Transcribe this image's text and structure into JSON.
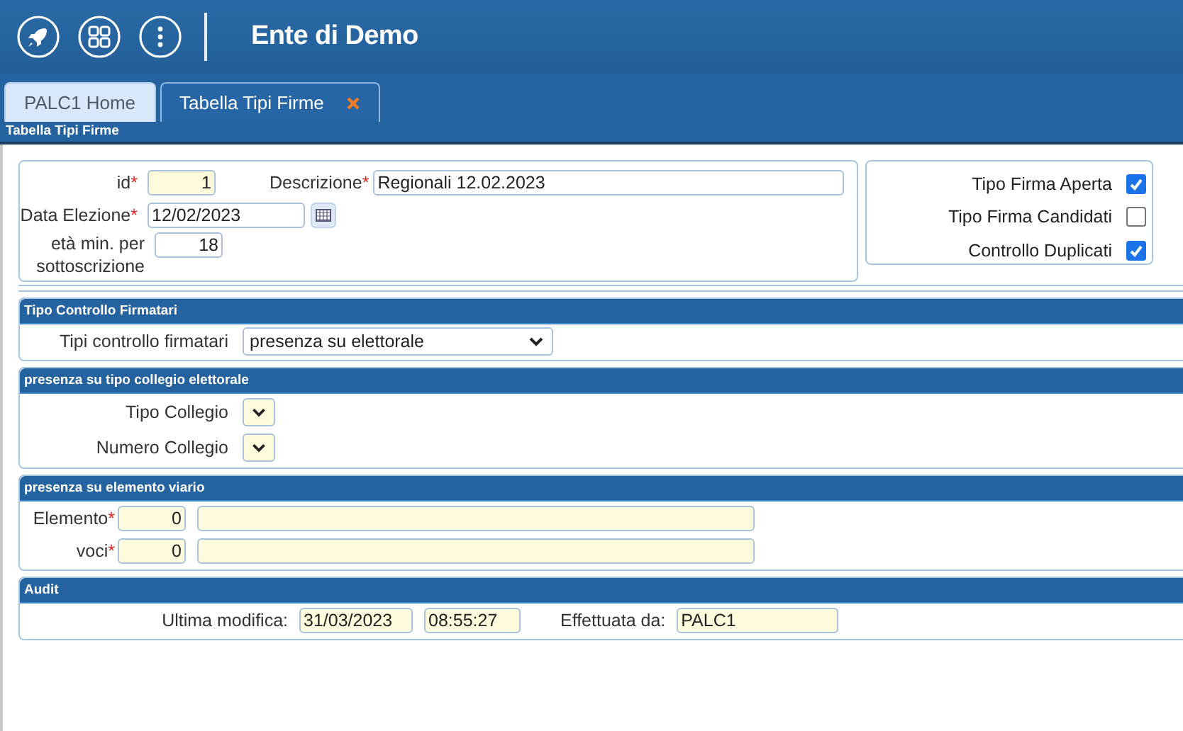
{
  "header": {
    "title": "Ente di Demo"
  },
  "tabs": [
    {
      "label": "PALC1 Home",
      "selected": false,
      "closable": false
    },
    {
      "label": "Tabella Tipi Firme",
      "selected": true,
      "closable": true
    }
  ],
  "page_title": "Tabella Tipi Firme",
  "general": {
    "id": {
      "label": "id",
      "asterisk": "*",
      "value": "1",
      "shaded": true
    },
    "descrizione": {
      "label": "Descrizione",
      "asterisk": "*",
      "value": "Regionali 12.02.2023",
      "shaded": false
    },
    "data_elezione": {
      "label": "Data Elezione",
      "asterisk": "*",
      "value": "12/02/2023",
      "shaded": false
    },
    "eta_min": {
      "label": "età min. per sottoscrizione",
      "value": "18",
      "shaded": false
    },
    "checkboxes": [
      {
        "label": "Tipo Firma Aperta",
        "checked": true
      },
      {
        "label": "Tipo Firma Candidati",
        "checked": false
      },
      {
        "label": "Controllo Duplicati",
        "checked": true
      }
    ]
  },
  "sections": [
    {
      "title": "Tipo Controllo Firmatari",
      "rows": [
        {
          "items": [
            {
              "kind": "label",
              "text": "Tipi controllo firmatari"
            },
            {
              "kind": "select",
              "value": "presenza su elettorale",
              "shaded": false
            }
          ]
        }
      ]
    },
    {
      "title": "presenza su tipo collegio elettorale",
      "rows": [
        {
          "items": [
            {
              "kind": "label",
              "text": "Tipo Collegio"
            },
            {
              "kind": "select",
              "shaded": true
            }
          ]
        },
        {
          "items": [
            {
              "kind": "label",
              "text": "Numero Collegio"
            },
            {
              "kind": "select",
              "shaded": true
            }
          ]
        }
      ]
    },
    {
      "title": "presenza su elemento viario",
      "rows": [
        {
          "items": [
            {
              "kind": "label",
              "text": "Elemento",
              "asterisk": "*"
            },
            {
              "kind": "number",
              "value": "0",
              "shaded": true
            },
            {
              "kind": "text",
              "shaded": true
            }
          ]
        },
        {
          "items": [
            {
              "kind": "label",
              "text": "voci",
              "asterisk": "*"
            },
            {
              "kind": "number",
              "value": "0",
              "shaded": true
            },
            {
              "kind": "text",
              "shaded": true
            }
          ]
        }
      ]
    },
    {
      "title": "Audit",
      "rows": [
        {
          "items": [
            {
              "kind": "label",
              "text": "Ultima modifica:"
            },
            {
              "kind": "date",
              "value": "31/03/2023",
              "shaded": true
            },
            {
              "kind": "time",
              "value": "08:55:27",
              "shaded": true
            },
            {
              "kind": "label",
              "text": "Effettuata da:"
            },
            {
              "kind": "text",
              "value": "PALC1",
              "shaded": true
            }
          ]
        }
      ]
    }
  ]
}
